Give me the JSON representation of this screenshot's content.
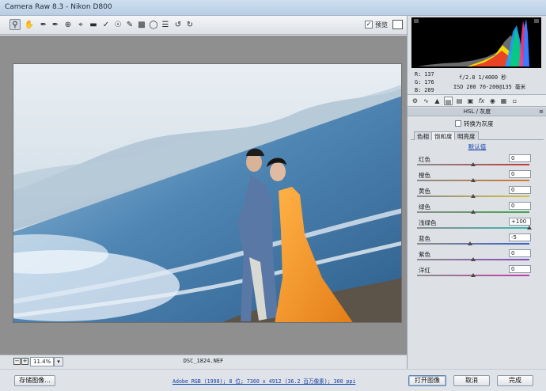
{
  "window": {
    "title": "Camera Raw 8.3 -  Nikon D800"
  },
  "toolbar": {
    "tools": [
      "zoom-icon",
      "hand-icon",
      "white-balance-icon",
      "color-sampler-icon",
      "target-adjust-icon",
      "crop-icon",
      "straighten-icon",
      "spot-removal-icon",
      "red-eye-icon",
      "adjustment-brush-icon",
      "graduated-filter-icon",
      "radial-filter-icon",
      "preferences-icon",
      "rotate-ccw-icon",
      "rotate-cw-icon"
    ],
    "preview_label": "预览",
    "preview_checked": true
  },
  "canvas": {
    "background": "#8f8f8f"
  },
  "statusbar": {
    "zoom_value": "11.4%",
    "filename": "DSC_1824.NEF"
  },
  "bottom": {
    "save_label": "存储图像...",
    "workflow_link": "Adobe RGB (1998); 8 位; 7360 x 4912 (36.2 百万像素); 300 ppi",
    "open_label": "打开图像",
    "cancel_label": "取消",
    "done_label": "完成"
  },
  "readouts": {
    "r": "R:   137",
    "g": "G:   176",
    "b": "B:   209",
    "exposure": "f/2.8   1/4000 秒",
    "iso": "ISO 200   70-200@135 毫米"
  },
  "panel": {
    "tabs": [
      "basic-icon",
      "tone-curve-icon",
      "detail-icon",
      "hsl-icon",
      "split-toning-icon",
      "lens-icon",
      "fx-icon",
      "camera-calibration-icon",
      "presets-icon"
    ],
    "section_title": "HSL / 灰度",
    "gray_label": "转换为灰度",
    "subtabs": [
      "色相",
      "饱和度",
      "明亮度"
    ],
    "active_subtab": 1,
    "default_label": "默认值",
    "sliders": [
      {
        "label": "红色",
        "value": "0",
        "level": 0,
        "color": "#c23a3a"
      },
      {
        "label": "橙色",
        "value": "0",
        "level": 0,
        "color": "#d8772b"
      },
      {
        "label": "黄色",
        "value": "0",
        "level": 0,
        "color": "#d6c23a"
      },
      {
        "label": "绿色",
        "value": "0",
        "level": 0,
        "color": "#3da84a"
      },
      {
        "label": "浅绿色",
        "value": "+100",
        "level": 100,
        "color": "#39b8b2"
      },
      {
        "label": "蓝色",
        "value": "-5",
        "level": -5,
        "color": "#3a63c8"
      },
      {
        "label": "紫色",
        "value": "0",
        "level": 0,
        "color": "#8a45c5"
      },
      {
        "label": "洋红",
        "value": "0",
        "level": 0,
        "color": "#c53aa8"
      }
    ]
  }
}
